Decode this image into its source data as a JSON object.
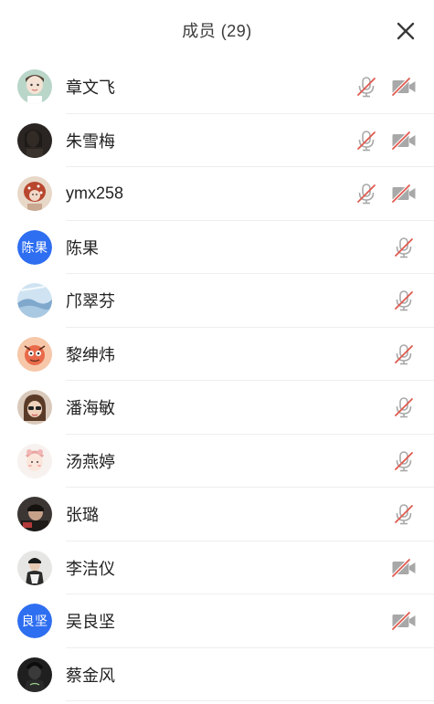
{
  "header": {
    "title": "成员 (29)"
  },
  "colors": {
    "accent": "#2e6ef0",
    "muted_icon": "#a8a8a8",
    "mute_slash": "#e05a4f"
  },
  "members": [
    {
      "name": "章文飞",
      "avatar": "photo",
      "mic_muted": true,
      "camera_off": true
    },
    {
      "name": "朱雪梅",
      "avatar": "photo",
      "mic_muted": true,
      "camera_off": true
    },
    {
      "name": "ymx258",
      "avatar": "photo",
      "mic_muted": true,
      "camera_off": true
    },
    {
      "name": "陈果",
      "avatar": "text",
      "avatar_text": "陈果",
      "mic_muted": true,
      "camera_off": false
    },
    {
      "name": "邝翠芬",
      "avatar": "photo",
      "mic_muted": true,
      "camera_off": false
    },
    {
      "name": "黎绅炜",
      "avatar": "photo",
      "mic_muted": true,
      "camera_off": false
    },
    {
      "name": "潘海敏",
      "avatar": "photo",
      "mic_muted": true,
      "camera_off": false
    },
    {
      "name": "汤燕婷",
      "avatar": "photo",
      "mic_muted": true,
      "camera_off": false
    },
    {
      "name": "张璐",
      "avatar": "photo",
      "mic_muted": true,
      "camera_off": false
    },
    {
      "name": "李洁仪",
      "avatar": "photo",
      "mic_muted": false,
      "camera_off": true
    },
    {
      "name": "吴良坚",
      "avatar": "text",
      "avatar_text": "良坚",
      "mic_muted": false,
      "camera_off": true
    },
    {
      "name": "蔡金风",
      "avatar": "photo",
      "mic_muted": false,
      "camera_off": false
    }
  ]
}
